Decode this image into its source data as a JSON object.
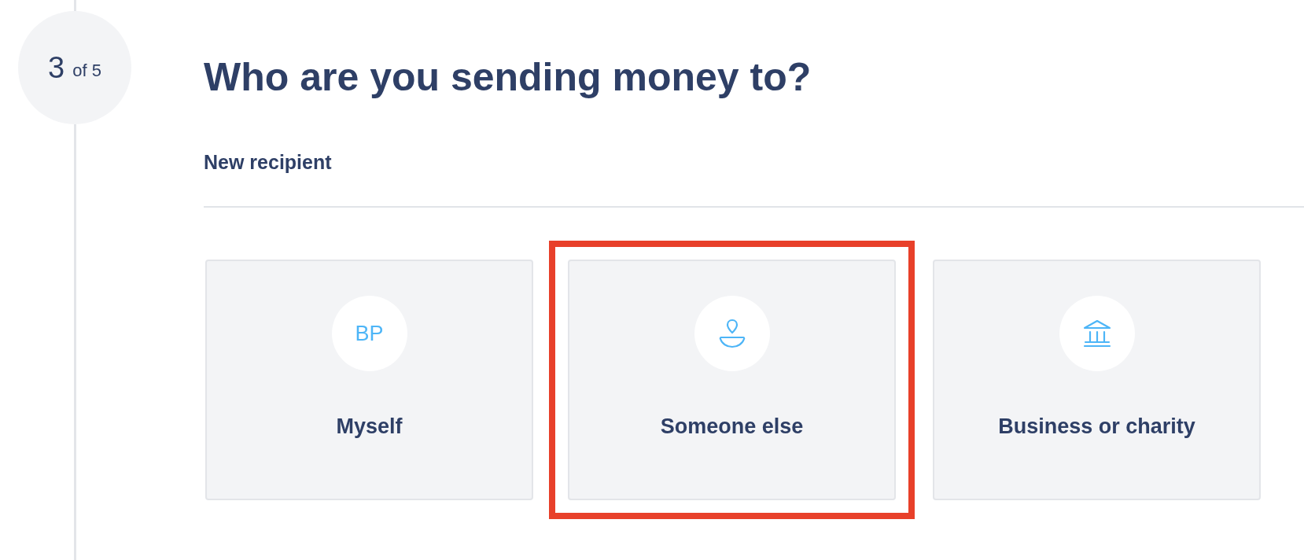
{
  "step": {
    "current": "3",
    "total": "of 5"
  },
  "heading": "Who are you sending money to?",
  "section_label": "New recipient",
  "options": [
    {
      "kind": "initials",
      "initials": "BP",
      "label": "Myself",
      "highlighted": false
    },
    {
      "kind": "person",
      "label": "Someone else",
      "highlighted": true
    },
    {
      "kind": "bank",
      "label": "Business or charity",
      "highlighted": false
    }
  ]
}
